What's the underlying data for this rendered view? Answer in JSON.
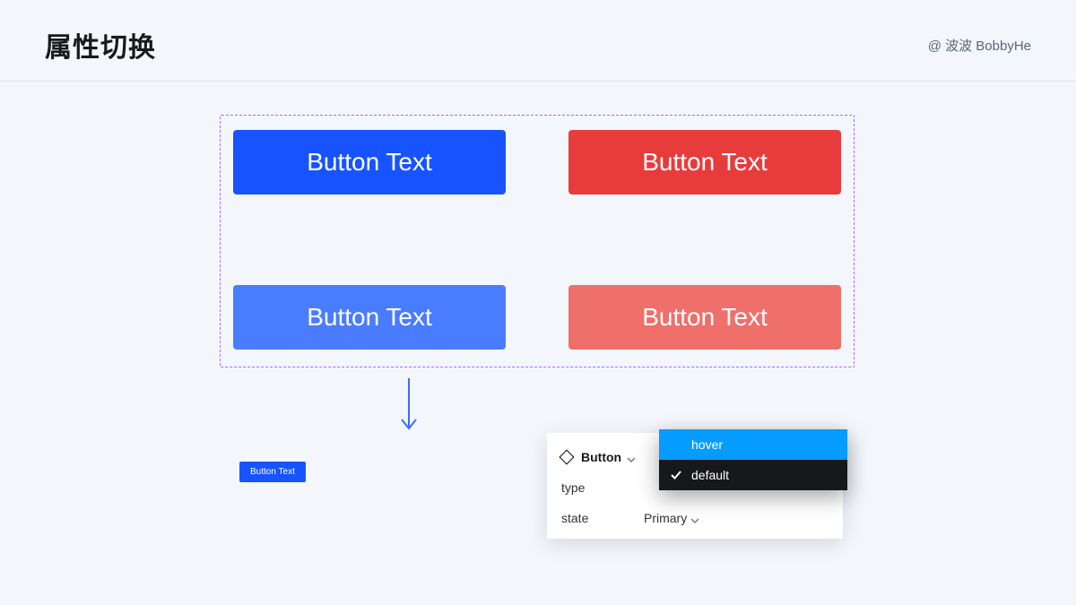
{
  "header": {
    "title": "属性切换",
    "credit": "@ 波波 BobbyHe"
  },
  "buttons": {
    "tl": "Button Text",
    "tr": "Button Text",
    "bl": "Button Text",
    "br": "Button Text"
  },
  "small_button_label": "Button Text",
  "panel": {
    "component_label": "Button",
    "rows": {
      "type_label": "type",
      "state_label": "state",
      "state_value": "Primary"
    }
  },
  "dropdown": {
    "options": [
      "hover",
      "default"
    ],
    "highlighted": "hover",
    "selected": "default"
  }
}
